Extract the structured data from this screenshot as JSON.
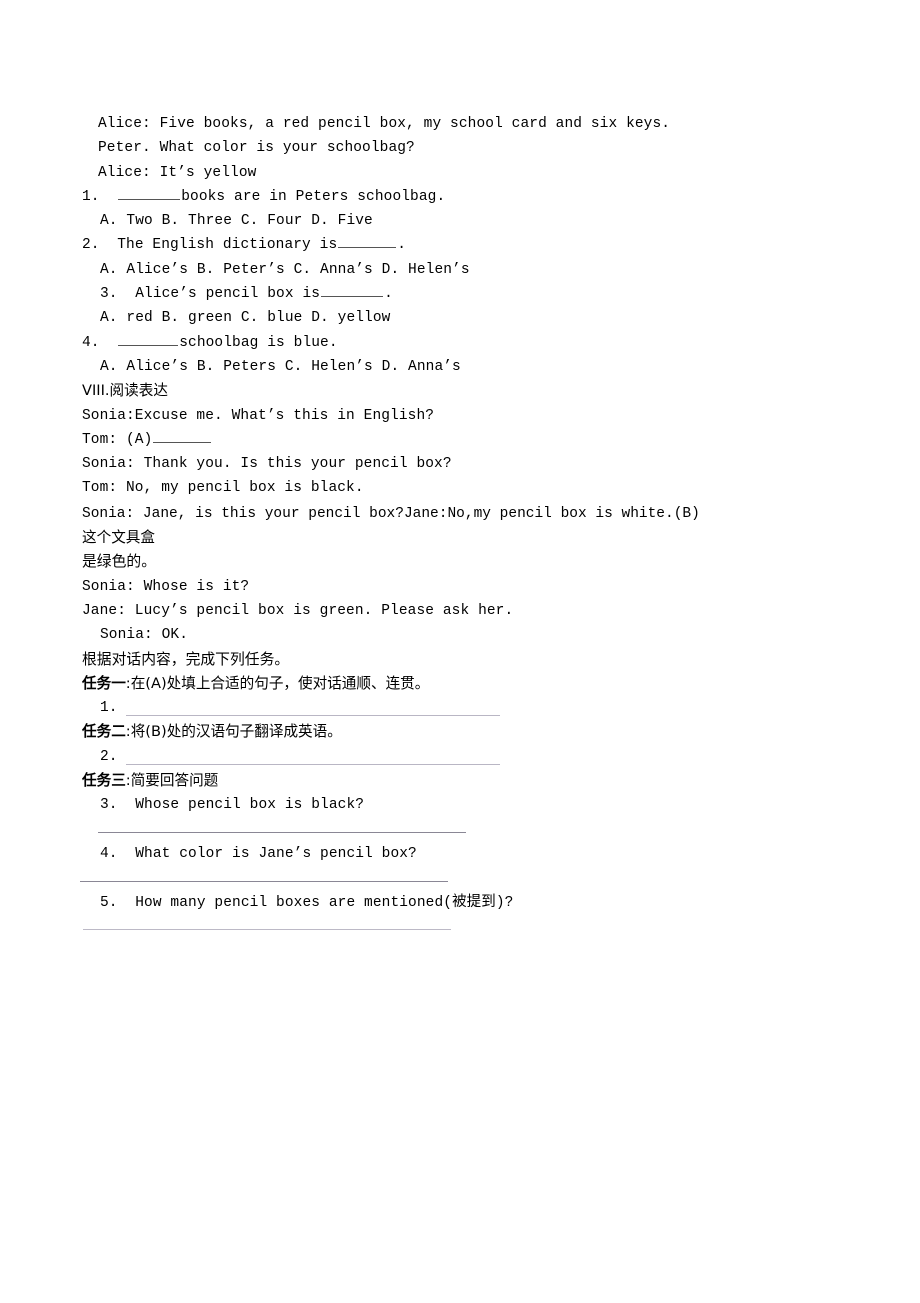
{
  "document": {
    "type": "english-exam-worksheet",
    "page_background": "#ffffff",
    "text_color": "#000000",
    "rule_color": "#b9b6c4"
  },
  "dialogue_top": {
    "lines": [
      "Alice:  Five  books,  a  red  pencil  box,  my  school  card  and  six  keys.",
      "Peter.  What  color  is  your  schoolbag?",
      "Alice:  It’s  yellow"
    ]
  },
  "multiple_choice": {
    "q1": {
      "number": "1.",
      "stem_after_blank": "books  are  in  Peters  schoolbag.",
      "options": "A.  Two B.  Three C.  Four D.  Five"
    },
    "q2": {
      "number": "2.",
      "stem_before_blank": "The  English  dictionary  is",
      "stem_after_blank": ".",
      "options": "A.  Alice’s      B.  Peter’s    C.  Anna’s    D.  Helen’s"
    },
    "q3": {
      "number": "3.",
      "stem_before_blank": "Alice’s  pencil  box  is",
      "stem_after_blank": ".",
      "options": "A.  red      B.  green      C.  blue    D.  yellow"
    },
    "q4": {
      "number": "4.",
      "stem_after_blank": "schoolbag  is  blue.",
      "options": "A.  Alice’s      B.  Peters    C.  Helen’s      D.  Anna’s"
    }
  },
  "section": {
    "heading": "VIII.阅读表达"
  },
  "dialogue_main": {
    "l1": "Sonia:Excuse  me.  What’s  this  in  English?",
    "l2_speaker": "Tom:   (A)",
    "l3": "Sonia:  Thank  you.  Is  this  your  pencil  box?",
    "l4": "Tom: No,  my  pencil  box  is  black.",
    "l5_latin": "Sonia:  Jane,  is  this  your  pencil  box?Jane:No,my  pencil  box  is  white.(B)",
    "l5_han": "这个文具盒",
    "l5_wrap_han": "是绿色的。",
    "l6": "Sonia:  Whose  is  it?",
    "l7": "Jane:  Lucy’s  pencil  box  is  green.  Please  ask  her.",
    "l8": "Sonia:  OK."
  },
  "instructions": {
    "intro": "根据对话内容，完成下列任务。",
    "task1_label": "任务一",
    "task1_body": ":在(A)处填上合适的句子，使对话通顺、连贯。",
    "task2_label": "任务二",
    "task2_body": ":将(B)处的汉语句子翻译成英语。",
    "task3_label": "任务三",
    "task3_body": ":简要回答问题"
  },
  "answers": {
    "a1_number": "1.",
    "a2_number": "2.",
    "q3_number": "3.",
    "q3_text": "Whose  pencil  box  is  black?",
    "q4_number": "4.",
    "q4_text": "What  color  is  Jane’s  pencil  box?",
    "q5_number": "5.",
    "q5_text": "How  many  pencil  boxes  are  mentioned(被提到)?"
  }
}
